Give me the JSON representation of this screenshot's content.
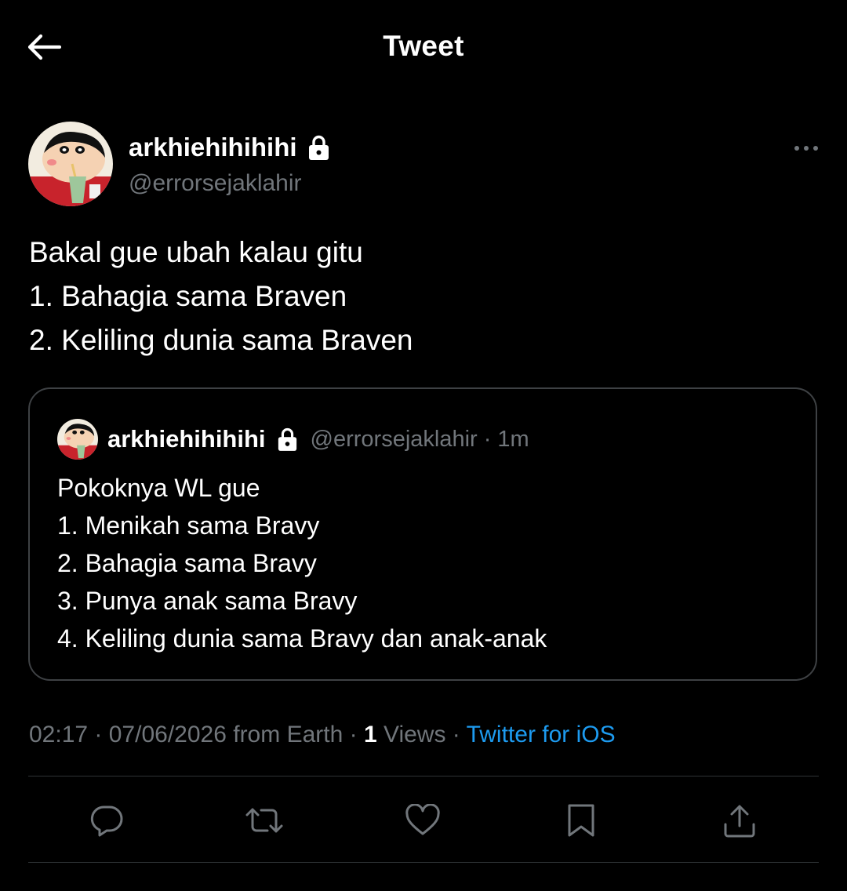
{
  "header": {
    "title": "Tweet",
    "back_icon": "arrow-left-icon"
  },
  "tweet": {
    "author_name": "arkhiehihihihi",
    "author_handle": "@errorsejaklahir",
    "protected_icon": "lock-icon",
    "more_icon": "more-horizontal-icon",
    "text_lines": [
      "Bakal gue ubah kalau gitu",
      "1. Bahagia sama Braven",
      "2. Keliling dunia sama Braven"
    ]
  },
  "quoted_tweet": {
    "author_name": "arkhiehihihihi",
    "author_handle": "@errorsejaklahir",
    "separator": "·",
    "time": "1m",
    "text_lines": [
      "Pokoknya WL gue",
      "1. Menikah sama Bravy",
      "2. Bahagia sama Bravy",
      "3. Punya anak sama Bravy",
      "4. Keliling dunia sama Bravy dan anak-anak"
    ]
  },
  "meta": {
    "time": "02:17",
    "sep1": " · ",
    "date_location": "07/06/2026 from Earth",
    "sep2": " · ",
    "views_count": "1",
    "views_label": " Views",
    "sep3": " · ",
    "source": "Twitter for iOS"
  },
  "actions": [
    {
      "icon": "reply-icon"
    },
    {
      "icon": "retweet-icon"
    },
    {
      "icon": "like-icon"
    },
    {
      "icon": "bookmark-icon"
    },
    {
      "icon": "share-icon"
    }
  ],
  "colors": {
    "background": "#000000",
    "text": "#ffffff",
    "secondary": "#71767b",
    "link": "#1d9bf0",
    "border": "#2f3336"
  }
}
